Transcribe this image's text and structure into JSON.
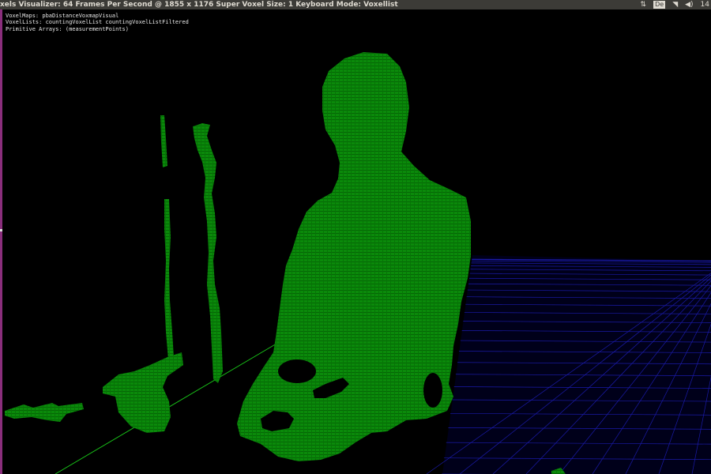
{
  "window": {
    "title": "xels Visualizer: 64 Frames Per Second @ 1855 x 1176 Super Voxel Size: 1 Keyboard Mode: Voxellist"
  },
  "tray": {
    "sort_icon": "⇅",
    "keyboard_layout": "De",
    "wifi_icon": "◥",
    "volume_icon": "◀)",
    "clock": "14"
  },
  "overlay": {
    "voxel_maps": "VoxelMaps: pbaDistanceVoxmapVisual",
    "voxel_lists": "VoxelLists: countingVoxelList countingVoxelListFiltered",
    "primitive_arrays": "Primitive Arrays: (measurementPoints)"
  },
  "colors": {
    "voxel_green": "#0a8a0a",
    "grid_blue": "#1a1aa8",
    "axis_green": "#18c018",
    "background": "#000000"
  }
}
